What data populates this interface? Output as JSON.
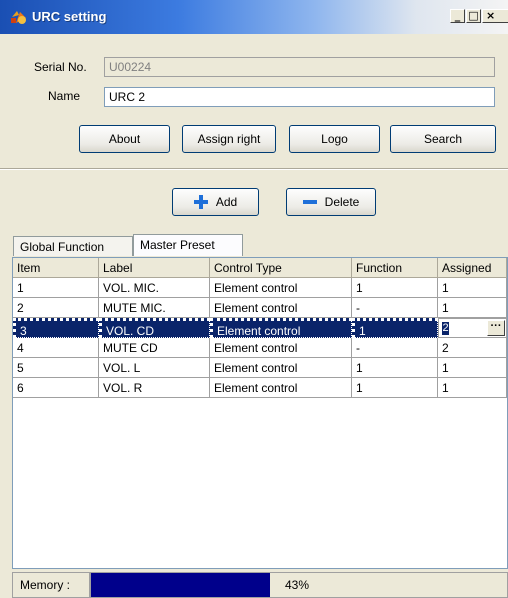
{
  "window": {
    "title": "URC setting",
    "min_glyph": "_",
    "max_glyph": "□",
    "close_glyph": "×"
  },
  "form": {
    "serial_label": "Serial No.",
    "serial_value": "U00224",
    "name_label": "Name",
    "name_value": "URC 2"
  },
  "buttons": {
    "about": "About",
    "assign_right": "Assign right",
    "logo": "Logo",
    "search": "Search",
    "add": "Add",
    "delete": "Delete"
  },
  "tabs": [
    {
      "label": "Global Function",
      "active": false
    },
    {
      "label": "Master Preset",
      "active": true
    }
  ],
  "grid": {
    "columns": [
      "Item",
      "Label",
      "Control Type",
      "Function",
      "Assigned"
    ],
    "rows": [
      [
        "1",
        "VOL. MIC.",
        "Element control",
        "1",
        "1"
      ],
      [
        "2",
        "MUTE MIC.",
        "Element control",
        "-",
        "1"
      ],
      [
        "3",
        "VOL. CD",
        "Element control",
        "1",
        "2"
      ],
      [
        "4",
        "MUTE CD",
        "Element control",
        "-",
        "2"
      ],
      [
        "5",
        "VOL. L",
        "Element control",
        "1",
        "1"
      ],
      [
        "6",
        "VOL. R",
        "Element control",
        "1",
        "1"
      ]
    ],
    "selected_row": 3,
    "editor_button": "···"
  },
  "memory": {
    "label": "Memory :",
    "percent_text": "43%",
    "fraction": 0.43
  },
  "colors": {
    "selection": "#0a246a",
    "progress": "#00008b",
    "add_icon": "#1e6fd9",
    "delete_icon": "#1e6fd9"
  },
  "icons": {
    "app": "colored-app-icon",
    "add": "plus-icon",
    "delete": "minus-icon"
  }
}
